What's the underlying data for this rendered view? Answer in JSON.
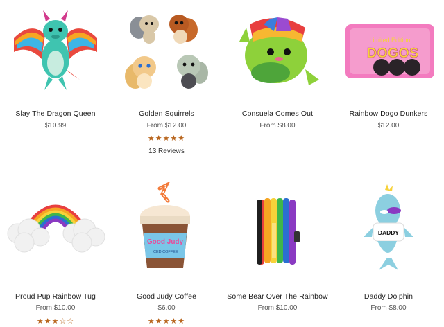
{
  "products": [
    {
      "name": "Slay The Dragon Queen",
      "price": "$10.99",
      "stars": "",
      "reviews": "",
      "icon": "rainbow-dragon-toy"
    },
    {
      "name": "Golden Squirrels",
      "price": "From $12.00",
      "stars": "★★★★★",
      "reviews": "13 Reviews",
      "icon": "squirrel-toys"
    },
    {
      "name": "Consuela Comes Out",
      "price": "From $8.00",
      "stars": "",
      "reviews": "",
      "icon": "cactus-toy"
    },
    {
      "name": "Rainbow Dogo Dunkers",
      "price": "$12.00",
      "stars": "",
      "reviews": "",
      "icon": "cookie-package-toy"
    },
    {
      "name": "Proud Pup Rainbow Tug",
      "price": "From $10.00",
      "stars": "★★★☆☆",
      "reviews": "",
      "icon": "rainbow-cloud-tug-toy"
    },
    {
      "name": "Good Judy Coffee",
      "price": "$6.00",
      "stars": "★★★★★",
      "reviews": "",
      "icon": "iced-coffee-toy"
    },
    {
      "name": "Some Bear Over The Rainbow",
      "price": "From $10.00",
      "stars": "",
      "reviews": "",
      "icon": "rainbow-bear-toy"
    },
    {
      "name": "Daddy Dolphin",
      "price": "From $8.00",
      "stars": "",
      "reviews": "",
      "icon": "dolphin-toy"
    }
  ],
  "printed_text": {
    "coffee_brand": "Good Judy",
    "coffee_sub": "ICED COFFEE",
    "package_top": "Limited Edition",
    "package_main": "DOGOS",
    "dolphin_shirt": "DADDY"
  },
  "colors": {
    "star": "#b8651d",
    "price": "#555555",
    "name": "#1e1e1e"
  }
}
